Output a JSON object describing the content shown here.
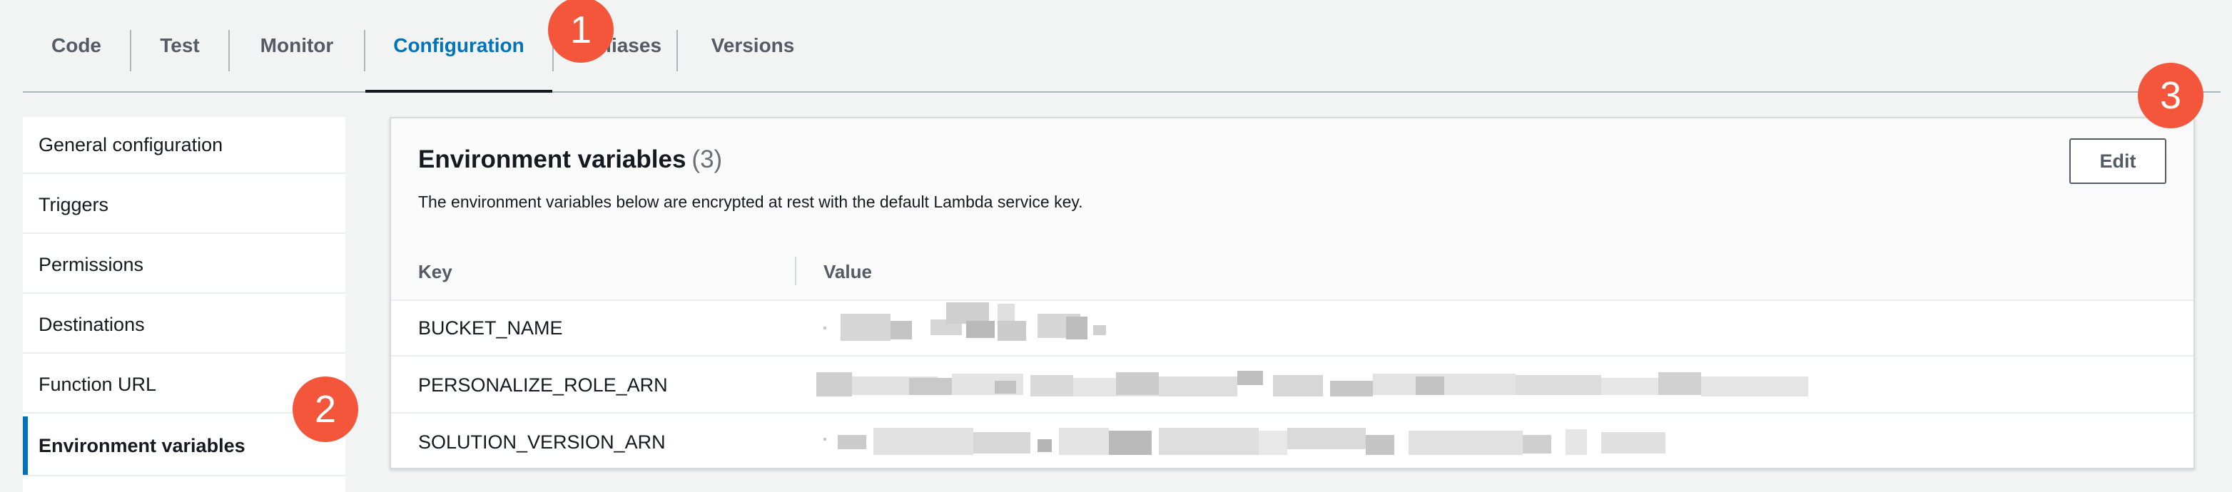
{
  "tabs": [
    {
      "label": "Code",
      "active": false
    },
    {
      "label": "Test",
      "active": false
    },
    {
      "label": "Monitor",
      "active": false
    },
    {
      "label": "Configuration",
      "active": true
    },
    {
      "label": "Aliases",
      "active": false
    },
    {
      "label": "Versions",
      "active": false
    }
  ],
  "sidebar": {
    "items": [
      {
        "label": "General configuration",
        "active": false
      },
      {
        "label": "Triggers",
        "active": false
      },
      {
        "label": "Permissions",
        "active": false
      },
      {
        "label": "Destinations",
        "active": false
      },
      {
        "label": "Function URL",
        "active": false
      },
      {
        "label": "Environment variables",
        "active": true
      }
    ]
  },
  "panel": {
    "title": "Environment variables",
    "count": "(3)",
    "description": "The environment variables below are encrypted at rest with the default Lambda service key.",
    "edit_label": "Edit",
    "columns": {
      "key": "Key",
      "value": "Value"
    },
    "rows": [
      {
        "key": "BUCKET_NAME",
        "value": "[redacted]"
      },
      {
        "key": "PERSONALIZE_ROLE_ARN",
        "value": "[redacted]"
      },
      {
        "key": "SOLUTION_VERSION_ARN",
        "value": "[redacted]"
      }
    ]
  },
  "callouts": [
    "1",
    "2",
    "3"
  ],
  "colors": {
    "accent": "#0073bb",
    "callout": "#f4563b",
    "text": "#16191f",
    "muted": "#545b64"
  }
}
